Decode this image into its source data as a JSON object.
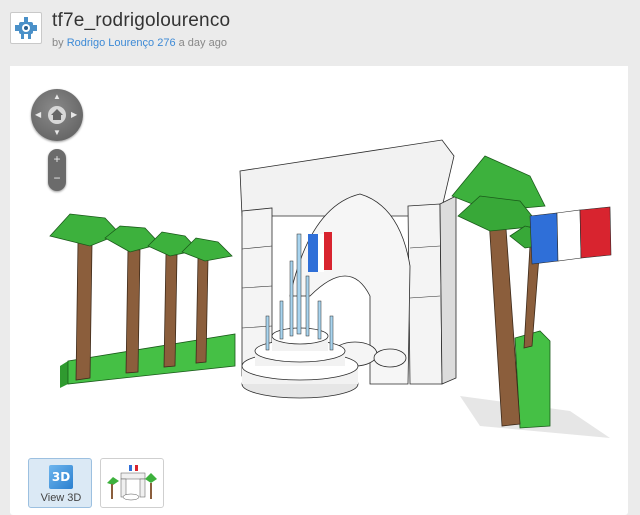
{
  "design": {
    "title": "tf7e_rodrigolourenco",
    "byline_prefix": "by",
    "author": "Rodrigo Lourenço",
    "author_score": "276",
    "time_ago": "a day ago"
  },
  "viewer": {
    "nav_icon": "navigation-pad-icon",
    "home_icon": "home-icon",
    "zoom_in": "+",
    "zoom_out": "−"
  },
  "thumbnails": {
    "view3d_badge": "3D",
    "view3d_label": "View 3D"
  },
  "colors": {
    "background": "#ebebeb",
    "link": "#3d8ad6",
    "leaf_green": "#3db13d",
    "trunk_brown": "#8b5e3c",
    "flag_blue": "#2f6fd8",
    "flag_red": "#d8242f"
  }
}
